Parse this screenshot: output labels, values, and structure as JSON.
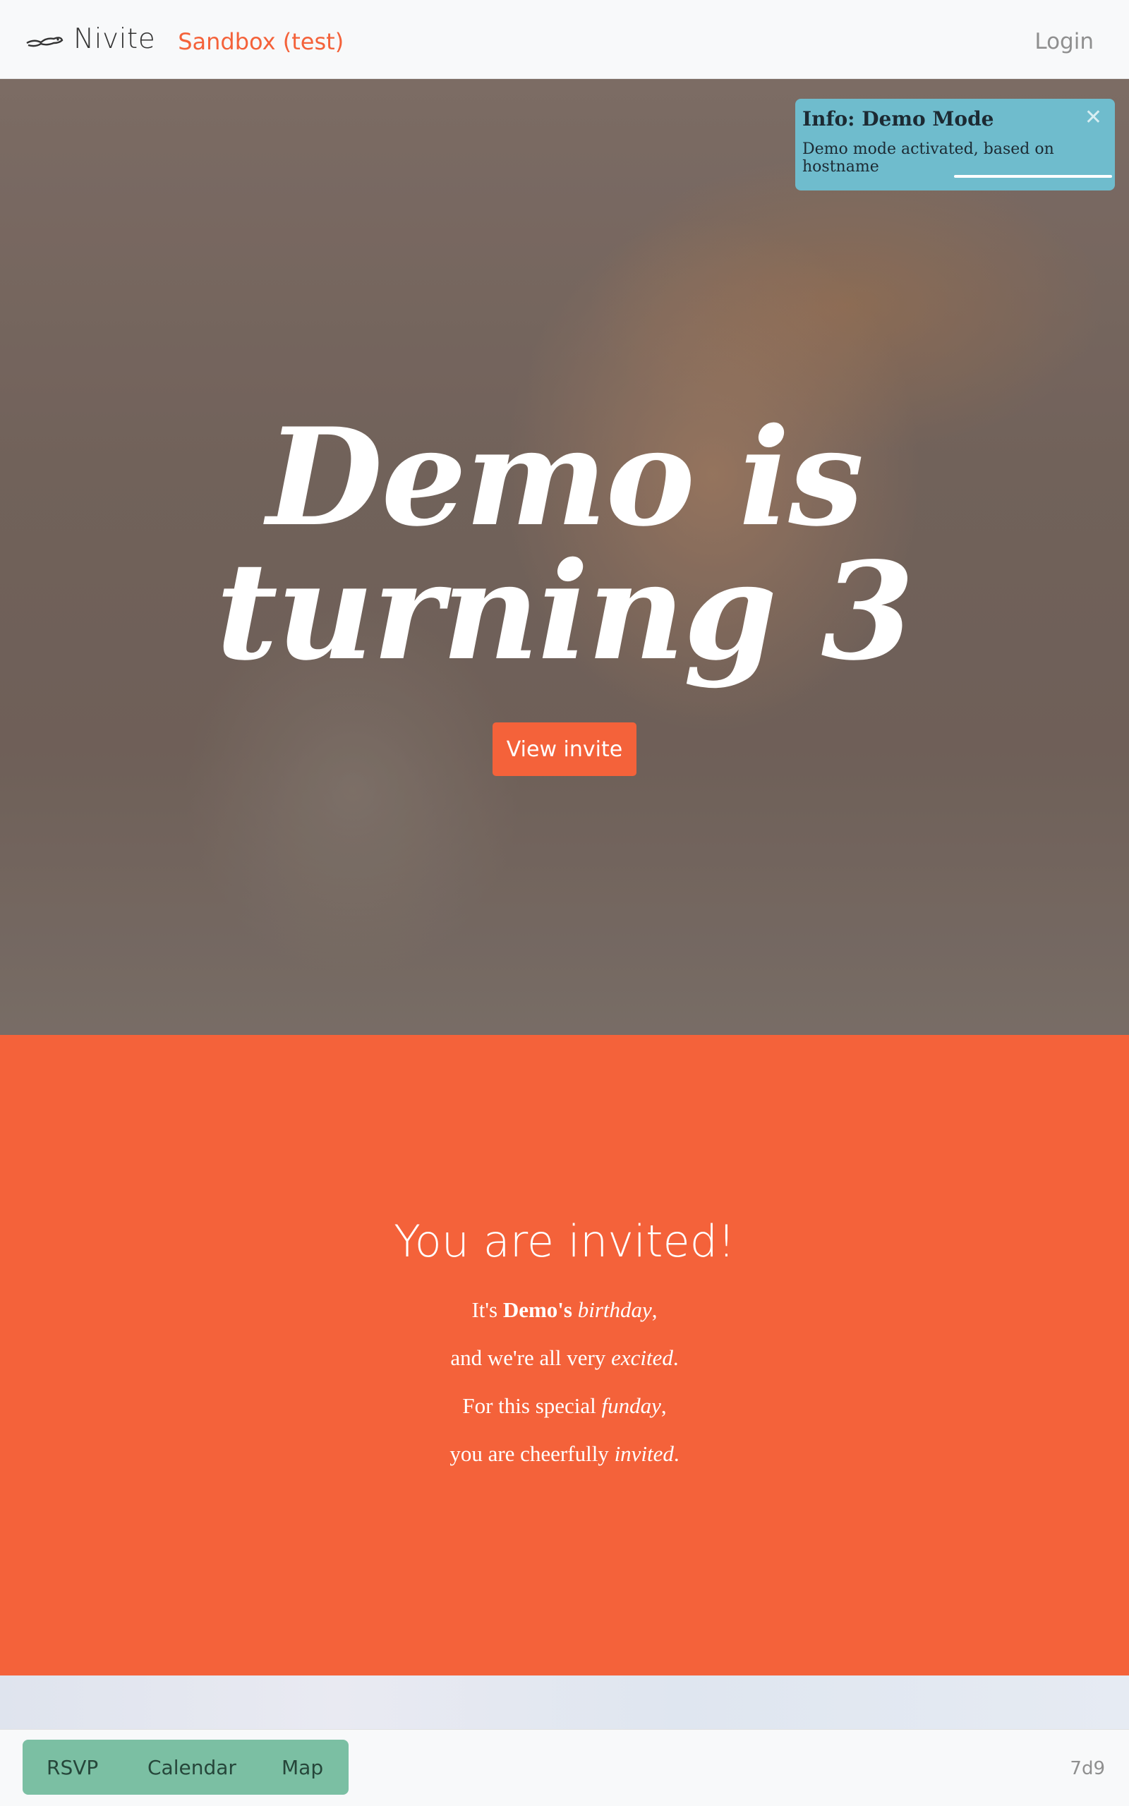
{
  "navbar": {
    "logo_icon": "bird-logo-icon",
    "brand": "Nivite",
    "environment": "Sandbox (test)",
    "login_label": "Login"
  },
  "toast": {
    "title": "Info: Demo Mode",
    "message": "Demo mode activated, based on hostname",
    "close_icon": "close-icon",
    "color": "#6fbccd"
  },
  "hero": {
    "title": "Demo is turning 3",
    "button_label": "View invite"
  },
  "invitation": {
    "heading": "You are invited!",
    "lines": [
      {
        "pre": "It's ",
        "bold": "Demo's",
        "mid": " ",
        "italic": "birthday",
        "post": ","
      },
      {
        "pre": "and we're all very ",
        "bold": "",
        "mid": "",
        "italic": "excited",
        "post": "."
      },
      {
        "pre": "For this special ",
        "bold": "",
        "mid": "",
        "italic": "funday",
        "post": ","
      },
      {
        "pre": "you are cheerfully ",
        "bold": "",
        "mid": "",
        "italic": "invited",
        "post": "."
      }
    ],
    "background_color": "#f4623a"
  },
  "bottom_nav": {
    "tabs": [
      "RSVP",
      "Calendar",
      "Map"
    ],
    "version": "7d9",
    "accent_color": "#7bbfa3"
  }
}
